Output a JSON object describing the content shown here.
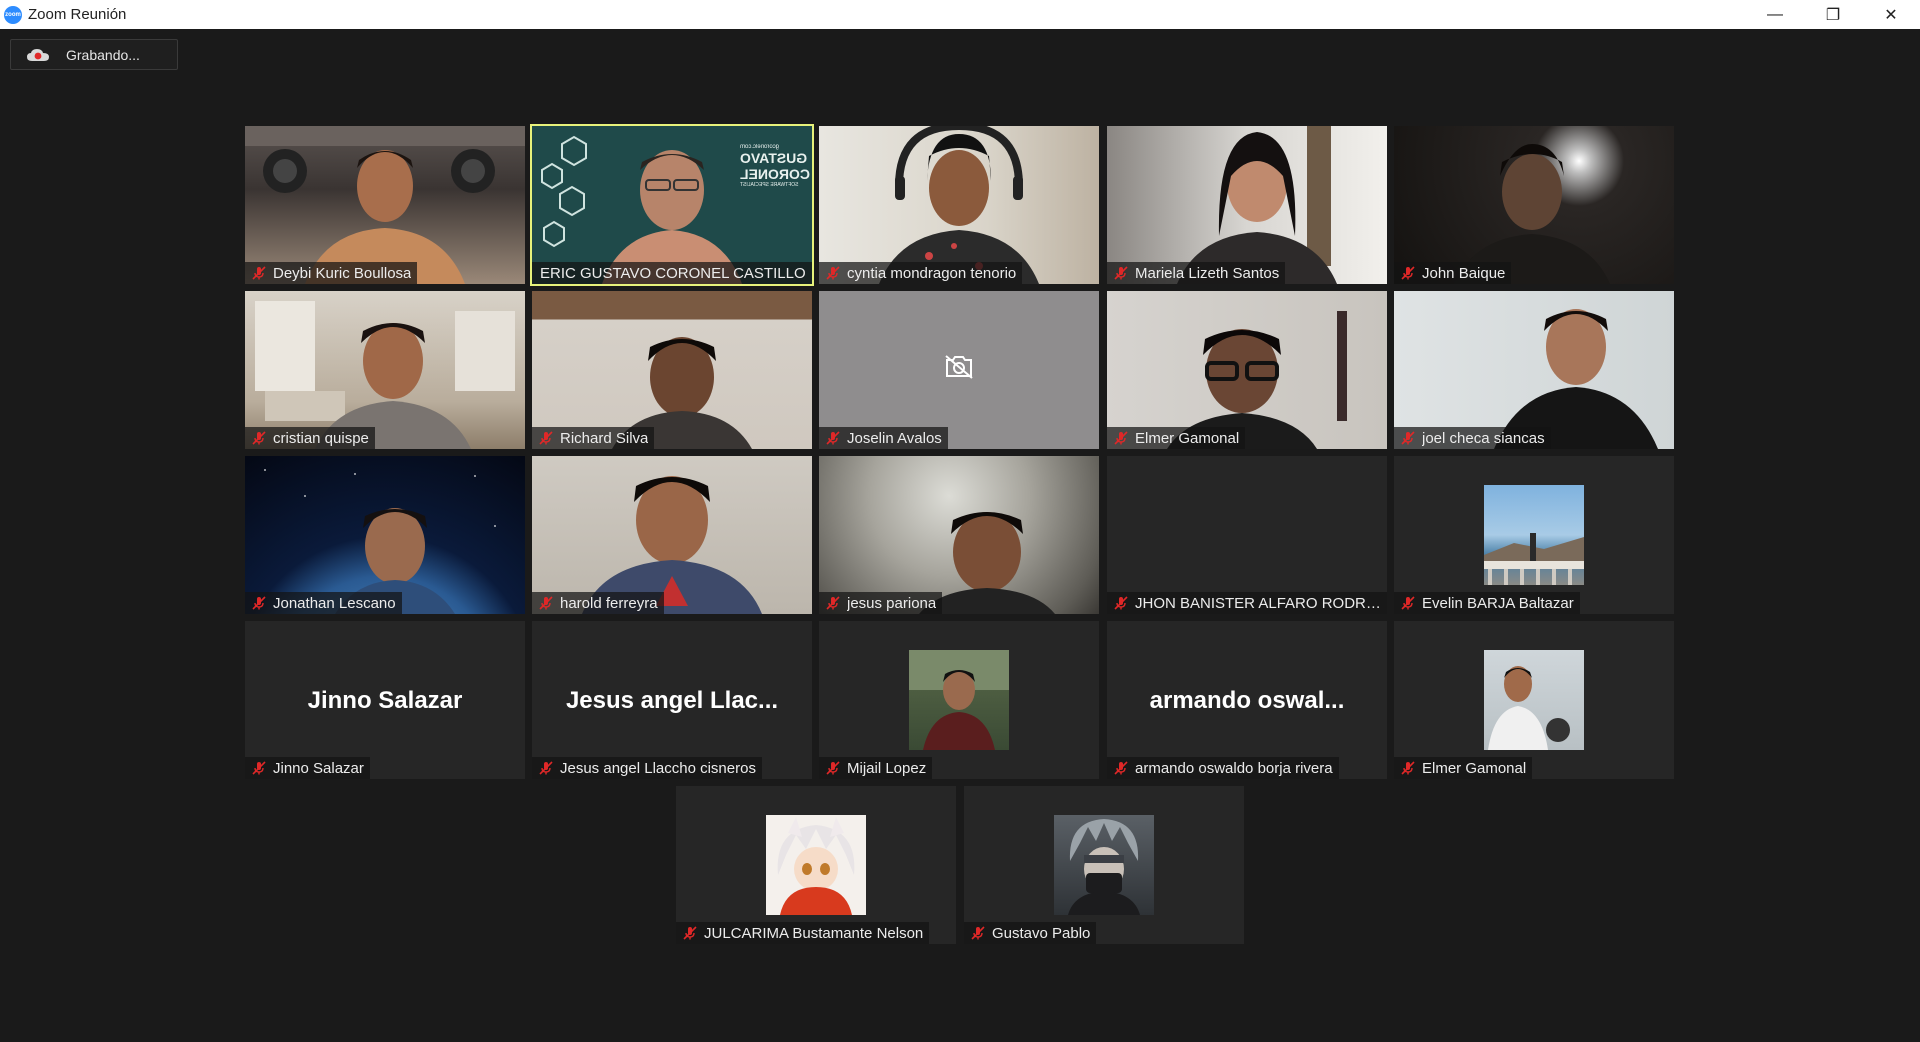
{
  "window": {
    "title": "Zoom Reunión",
    "app_icon_label": "zoom",
    "controls": {
      "minimize": "—",
      "restore": "❐",
      "close": "✕"
    }
  },
  "recording": {
    "label": "Grabando..."
  },
  "participants": [
    {
      "name": "Deybi Kuric Boullosa",
      "type": "video",
      "muted": true
    },
    {
      "name": "ERIC GUSTAVO CORONEL CASTILLO",
      "type": "video",
      "muted": false,
      "active_speaker": true,
      "background_text": {
        "line1": "GUSTAVO",
        "line2": "CORONEL",
        "line3": "SOFTWARE SPECIALIST",
        "url": "gcoronelc.com"
      }
    },
    {
      "name": "cyntia mondragon tenorio",
      "type": "video",
      "muted": true
    },
    {
      "name": "Mariela Lizeth Santos",
      "type": "video",
      "muted": true
    },
    {
      "name": "John Baique",
      "type": "video",
      "muted": true
    },
    {
      "name": "cristian quispe",
      "type": "video",
      "muted": true
    },
    {
      "name": "Richard Silva",
      "type": "video",
      "muted": true
    },
    {
      "name": "Joselin Avalos",
      "type": "camera-off",
      "muted": true
    },
    {
      "name": "Elmer Gamonal",
      "type": "video",
      "muted": true
    },
    {
      "name": "joel checa siancas",
      "type": "video",
      "muted": true
    },
    {
      "name": "Jonathan Lescano",
      "type": "video",
      "muted": true
    },
    {
      "name": "harold ferreyra",
      "type": "video",
      "muted": true
    },
    {
      "name": "jesus pariona",
      "type": "video",
      "muted": true
    },
    {
      "name": "JHON BANISTER ALFARO RODRIG...",
      "type": "blank",
      "muted": true
    },
    {
      "name": "Evelin BARJA  Baltazar",
      "type": "avatar",
      "muted": true
    },
    {
      "name": "Jinno Salazar",
      "display_name": "Jinno Salazar",
      "type": "text",
      "muted": true
    },
    {
      "name": "Jesus angel Llaccho cisneros",
      "display_name": "Jesus  angel  Llac...",
      "type": "text",
      "muted": true
    },
    {
      "name": "Mijail Lopez",
      "type": "avatar",
      "muted": true
    },
    {
      "name": "armando oswaldo borja rivera",
      "display_name": "armando  oswal...",
      "type": "text",
      "muted": true
    },
    {
      "name": "Elmer Gamonal",
      "type": "avatar",
      "muted": true
    },
    {
      "name": "JULCARIMA Bustamante Nelson",
      "type": "avatar",
      "muted": true
    },
    {
      "name": "Gustavo Pablo",
      "type": "avatar",
      "muted": true
    }
  ],
  "colors": {
    "background": "#1a1a1a",
    "tile": "#262626",
    "active_border": "#e7f27b",
    "muted_icon": "#e02828"
  }
}
